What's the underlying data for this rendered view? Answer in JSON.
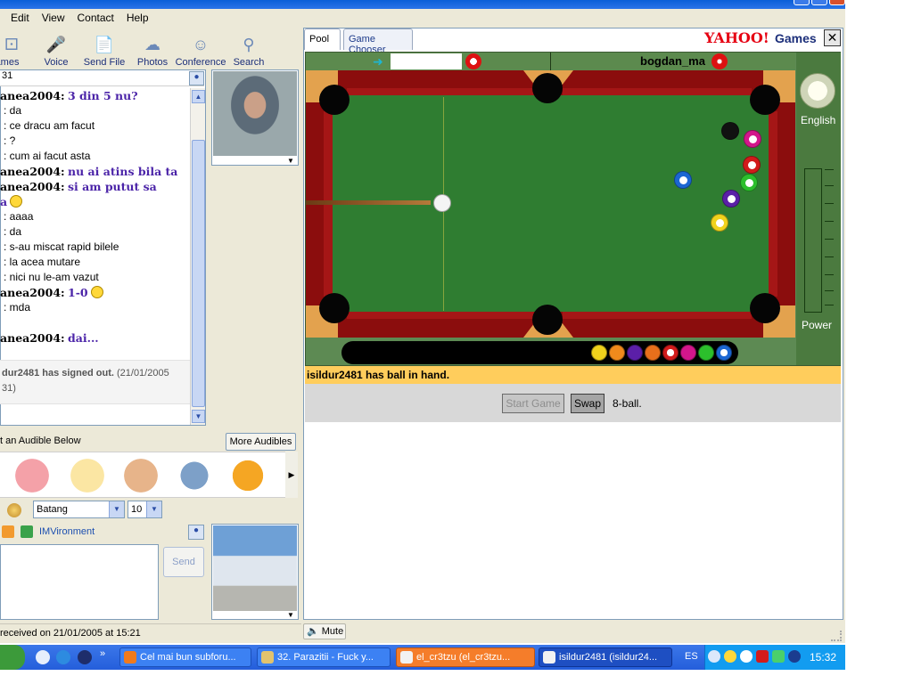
{
  "menu": [
    "Edit",
    "View",
    "Contact",
    "Help"
  ],
  "toolbar": [
    {
      "label": "Games",
      "icon": "dice-icon"
    },
    {
      "label": "Voice",
      "icon": "microphone-icon"
    },
    {
      "label": "Send File",
      "icon": "file-icon"
    },
    {
      "label": "Photos",
      "icon": "photos-icon"
    },
    {
      "label": "Conference",
      "icon": "conference-icon"
    },
    {
      "label": "Search",
      "icon": "search-icon"
    }
  ],
  "chat": {
    "header": "31",
    "lines": [
      {
        "nick": "anea2004:",
        "text": "3 din 5 nu?",
        "style": "purple"
      },
      {
        "nick": "",
        "text": ": da",
        "style": "plain"
      },
      {
        "nick": "",
        "text": ": ce dracu am facut",
        "style": "plain"
      },
      {
        "nick": "",
        "text": ": ?",
        "style": "plain"
      },
      {
        "nick": "",
        "text": ": cum ai facut asta",
        "style": "plain"
      },
      {
        "nick": "anea2004:",
        "text": "nu ai atins bila ta",
        "style": "purple"
      },
      {
        "nick": "anea2004:",
        "text": "si am putut sa",
        "style": "purple"
      },
      {
        "nick": "",
        "text": "a",
        "style": "purple",
        "smiley": true
      },
      {
        "nick": "",
        "text": ": aaaa",
        "style": "plain"
      },
      {
        "nick": "",
        "text": ": da",
        "style": "plain"
      },
      {
        "nick": "",
        "text": ": s-au miscat rapid bilele",
        "style": "plain"
      },
      {
        "nick": "",
        "text": ": la acea mutare",
        "style": "plain"
      },
      {
        "nick": "",
        "text": ": nici nu le-am vazut",
        "style": "plain"
      },
      {
        "nick": "anea2004:",
        "text": "1-0",
        "style": "purple",
        "smiley": true
      },
      {
        "nick": "",
        "text": ": mda",
        "style": "plain"
      },
      {
        "nick": "",
        "text": "",
        "style": "plain"
      },
      {
        "nick": "anea2004:",
        "text": "dai...",
        "style": "purple"
      }
    ],
    "signout_bold": "dur2481 has signed out.",
    "signout_time": "(21/01/2005",
    "signout_time2": "31)"
  },
  "audibles": {
    "label": "t an Audible Below",
    "more_button": "More Audibles"
  },
  "format": {
    "font": "Batang",
    "size": "10"
  },
  "imvironment": "IMVironment",
  "send_button": "Send",
  "status_bar": "received on 21/01/2005 at 15:21",
  "game": {
    "tabs": [
      "Pool",
      "Game Chooser"
    ],
    "brand": "YAHOO!",
    "brand_games": "Games",
    "player2": "bogdan_ma",
    "language": "English",
    "power_label": "Power",
    "status": "isildur2481 has ball in hand.",
    "start_button": "Start Game",
    "swap_button": "Swap",
    "game_type": "8-ball.",
    "mute_button": "Mute"
  },
  "taskbar": {
    "tasks": [
      "Cel mai bun subforu...",
      "32. Parazitii - Fuck y...",
      "el_cr3tzu  (el_cr3tzu...",
      "isildur2481  (isildur24..."
    ],
    "language": "ES",
    "clock": "15:32"
  },
  "colors": {
    "felt": "#2f7d31",
    "rail": "#8b0d0d",
    "status_bg": "#ffcd5c",
    "purple_text": "#4b24a8"
  }
}
